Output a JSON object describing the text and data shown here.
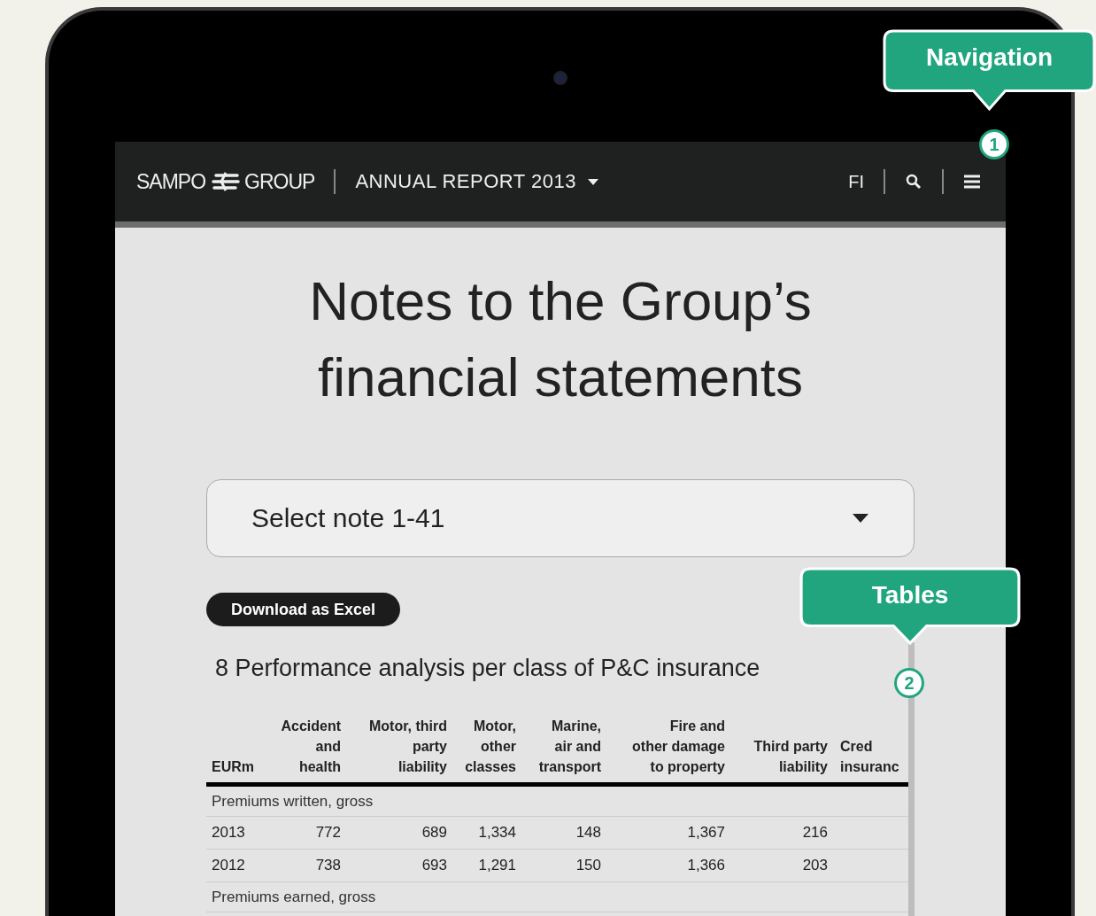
{
  "header": {
    "brand_left": "SAMPO",
    "brand_right": "GROUP",
    "report_menu": "ANNUAL REPORT 2013",
    "language": "FI"
  },
  "page": {
    "title": "Notes to the Group’s financial statements",
    "note_select": {
      "value": "Select note 1-41"
    },
    "download_button": "Download as Excel",
    "table": {
      "title": "8 Performance analysis per class of P&C insurance",
      "columns": [
        "EURm",
        "Accident\nand\nhealth",
        "Motor, third\nparty\nliability",
        "Motor,\nother\nclasses",
        "Marine,\nair and\ntransport",
        "Fire and\nother damage\nto property",
        "Third party\nliability",
        "Cred\ninsuranc"
      ],
      "rows": [
        {
          "kind": "group",
          "label": "Premiums written, gross"
        },
        {
          "kind": "data",
          "label": "2013",
          "values": [
            "772",
            "689",
            "1,334",
            "148",
            "1,367",
            "216"
          ]
        },
        {
          "kind": "data",
          "label": "2012",
          "values": [
            "738",
            "693",
            "1,291",
            "150",
            "1,366",
            "203"
          ]
        },
        {
          "kind": "group",
          "label": "Premiums earned, gross"
        }
      ]
    }
  },
  "callouts": [
    {
      "label": "Navigation",
      "number": "1"
    },
    {
      "label": "Tables",
      "number": "2"
    }
  ]
}
